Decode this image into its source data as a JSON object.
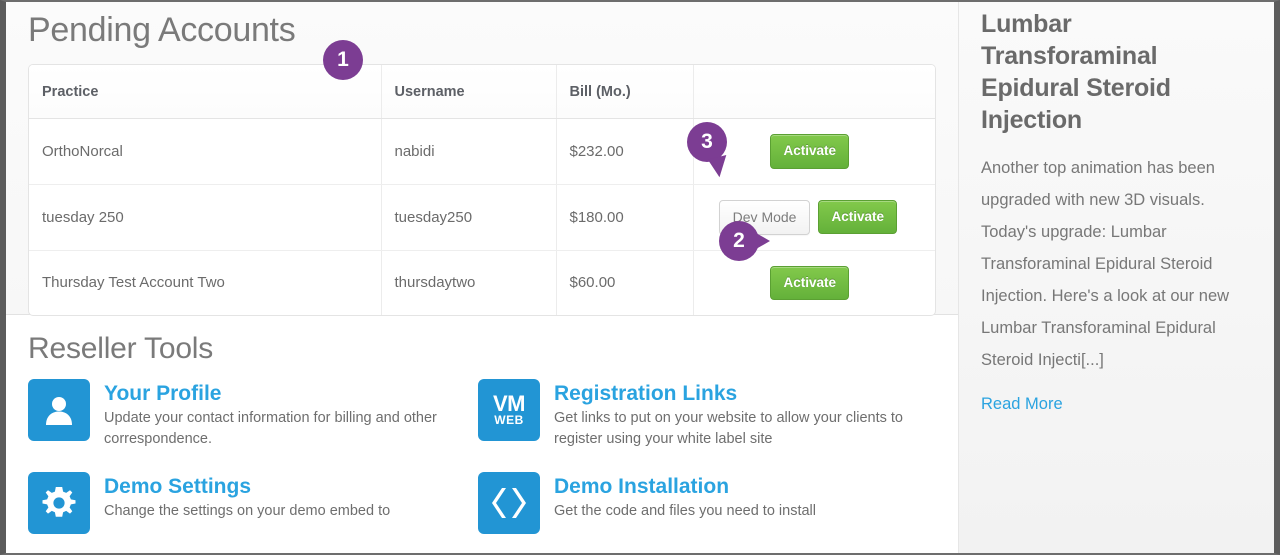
{
  "main": {
    "page_title": "Pending Accounts",
    "table": {
      "columns": [
        "Practice",
        "Username",
        "Bill (Mo.)",
        ""
      ],
      "rows": [
        {
          "practice": "OrthoNorcal",
          "username": "nabidi",
          "bill": "$232.00",
          "buttons": [
            "Activate"
          ]
        },
        {
          "practice": "tuesday 250",
          "username": "tuesday250",
          "bill": "$180.00",
          "buttons": [
            "Dev Mode",
            "Activate"
          ]
        },
        {
          "practice": "Thursday Test Account Two",
          "username": "thursdaytwo",
          "bill": "$60.00",
          "buttons": [
            "Activate"
          ]
        }
      ]
    },
    "callouts": [
      {
        "number": "1"
      },
      {
        "number": "2"
      },
      {
        "number": "3"
      }
    ],
    "tools_title": "Reseller Tools",
    "tools": [
      {
        "icon": "user-icon",
        "title": "Your Profile",
        "desc": "Update your contact information for billing and other correspondence."
      },
      {
        "icon": "vm-web-icon",
        "icon_text": "VM",
        "icon_subtext": "WEB",
        "title": "Registration Links",
        "desc": "Get links to put on your website to allow your clients to register using your white label site"
      },
      {
        "icon": "gear-icon",
        "title": "Demo Settings",
        "desc": "Change the settings on your demo embed to"
      },
      {
        "icon": "code-icon",
        "title": "Demo Installation",
        "desc": "Get the code and files you need to install"
      }
    ]
  },
  "sidebar": {
    "title": "Lumbar Transforaminal Epidural Steroid Injection",
    "body": "Another top animation has been upgraded with new 3D visuals. Today's upgrade: Lumbar Transforaminal Epidural Steroid Injection. Here's a look at our new Lumbar Transforaminal Epidural Steroid Injecti[...]",
    "read_more": "Read More"
  },
  "colors": {
    "callout_purple": "#7c3d93",
    "activate_green": "#64b13a",
    "link_blue": "#2aa3e0",
    "icon_blue": "#2295d4",
    "title_gray": "#7a7a7a"
  }
}
